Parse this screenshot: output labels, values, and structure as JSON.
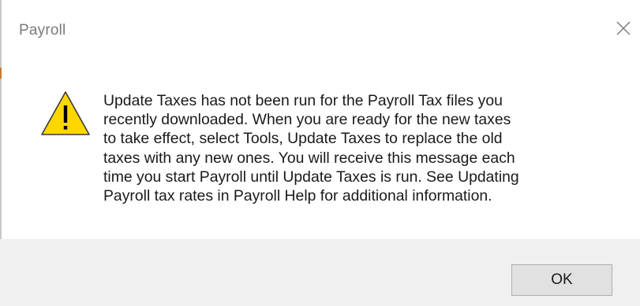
{
  "window": {
    "title": "Payroll",
    "close_icon": "close-icon"
  },
  "dialog": {
    "icon": "warning-icon",
    "message_lines": [
      "Update Taxes has not been run for the Payroll Tax files you",
      "recently downloaded. When you are ready for the new taxes",
      "to take effect, select Tools, Update Taxes to replace the old",
      "taxes with any new ones. You will receive this message each",
      "time you start Payroll until Update Taxes is run. See Updating",
      "Payroll tax rates in Payroll Help for additional information."
    ]
  },
  "buttons": {
    "ok_label": "OK"
  },
  "colors": {
    "warning_fill": "#ffd700",
    "footer_bg": "#f0f0f0",
    "button_bg": "#e1e1e1"
  }
}
